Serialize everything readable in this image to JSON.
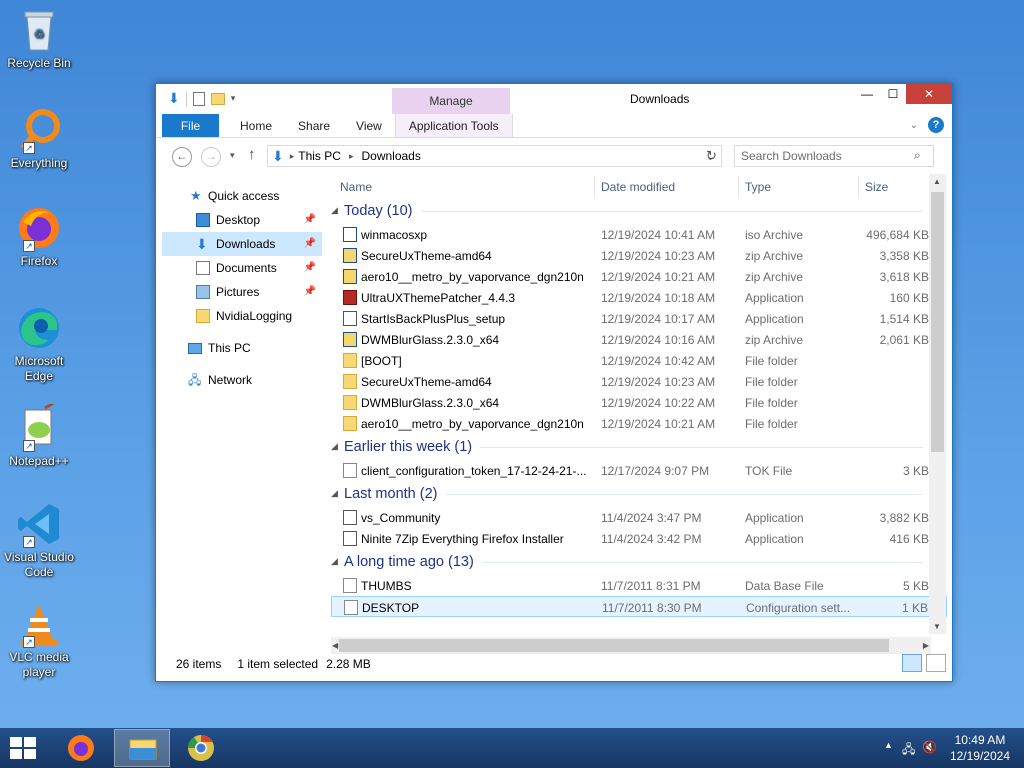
{
  "desktop": {
    "icons": [
      {
        "label": "Recycle Bin",
        "icon": "recycle-bin-icon"
      },
      {
        "label": "Everything",
        "icon": "everything-icon"
      },
      {
        "label": "Firefox",
        "icon": "firefox-icon"
      },
      {
        "label": "Microsoft Edge",
        "icon": "edge-icon"
      },
      {
        "label": "Notepad++",
        "icon": "notepadpp-icon"
      },
      {
        "label": "Visual Studio Code",
        "icon": "vscode-icon"
      },
      {
        "label": "VLC media player",
        "icon": "vlc-icon"
      }
    ]
  },
  "window": {
    "title": "Downloads",
    "manage_tab": "Manage",
    "ribbon": {
      "file": "File",
      "tabs": [
        "Home",
        "Share",
        "View",
        "Application Tools"
      ]
    },
    "address": {
      "segments": [
        "This PC",
        "Downloads"
      ]
    },
    "search": {
      "placeholder": "Search Downloads"
    },
    "nav": {
      "quick_access": "Quick access",
      "items": [
        {
          "label": "Desktop",
          "pinned": true
        },
        {
          "label": "Downloads",
          "pinned": true,
          "selected": true
        },
        {
          "label": "Documents",
          "pinned": true
        },
        {
          "label": "Pictures",
          "pinned": true
        },
        {
          "label": "NvidiaLogging",
          "pinned": false
        }
      ],
      "this_pc": "This PC",
      "network": "Network"
    },
    "columns": {
      "name": "Name",
      "date": "Date modified",
      "type": "Type",
      "size": "Size"
    },
    "groups": [
      {
        "title": "Today (10)",
        "files": [
          {
            "name": "winmacosxp",
            "date": "12/19/2024 10:41 AM",
            "type": "iso Archive",
            "size": "496,684 KB",
            "icon": "iso"
          },
          {
            "name": "SecureUxTheme-amd64",
            "date": "12/19/2024 10:23 AM",
            "type": "zip Archive",
            "size": "3,358 KB",
            "icon": "zip"
          },
          {
            "name": "aero10__metro_by_vaporvance_dgn210n",
            "date": "12/19/2024 10:21 AM",
            "type": "zip Archive",
            "size": "3,618 KB",
            "icon": "zip"
          },
          {
            "name": "UltraUXThemePatcher_4.4.3",
            "date": "12/19/2024 10:18 AM",
            "type": "Application",
            "size": "160 KB",
            "icon": "red"
          },
          {
            "name": "StartIsBackPlusPlus_setup",
            "date": "12/19/2024 10:17 AM",
            "type": "Application",
            "size": "1,514 KB",
            "icon": "app"
          },
          {
            "name": "DWMBlurGlass.2.3.0_x64",
            "date": "12/19/2024 10:16 AM",
            "type": "zip Archive",
            "size": "2,061 KB",
            "icon": "zip"
          },
          {
            "name": "[BOOT]",
            "date": "12/19/2024 10:42 AM",
            "type": "File folder",
            "size": "",
            "icon": "folder"
          },
          {
            "name": "SecureUxTheme-amd64",
            "date": "12/19/2024 10:23 AM",
            "type": "File folder",
            "size": "",
            "icon": "folder"
          },
          {
            "name": "DWMBlurGlass.2.3.0_x64",
            "date": "12/19/2024 10:22 AM",
            "type": "File folder",
            "size": "",
            "icon": "folder"
          },
          {
            "name": "aero10__metro_by_vaporvance_dgn210n",
            "date": "12/19/2024 10:21 AM",
            "type": "File folder",
            "size": "",
            "icon": "folder"
          }
        ]
      },
      {
        "title": "Earlier this week (1)",
        "files": [
          {
            "name": "client_configuration_token_17-12-24-21-...",
            "date": "12/17/2024 9:07 PM",
            "type": "TOK File",
            "size": "3 KB",
            "icon": "file"
          }
        ]
      },
      {
        "title": "Last month (2)",
        "files": [
          {
            "name": "vs_Community",
            "date": "11/4/2024 3:47 PM",
            "type": "Application",
            "size": "3,882 KB",
            "icon": "app"
          },
          {
            "name": "Ninite 7Zip Everything Firefox Installer",
            "date": "11/4/2024 3:42 PM",
            "type": "Application",
            "size": "416 KB",
            "icon": "app"
          }
        ]
      },
      {
        "title": "A long time ago (13)",
        "files": [
          {
            "name": "THUMBS",
            "date": "11/7/2011 8:31 PM",
            "type": "Data Base File",
            "size": "5 KB",
            "icon": "file"
          },
          {
            "name": "DESKTOP",
            "date": "11/7/2011 8:30 PM",
            "type": "Configuration sett...",
            "size": "1 KB",
            "icon": "file",
            "selected": true
          }
        ]
      }
    ],
    "status": {
      "count": "26 items",
      "selection": "1 item selected",
      "size": "2.28 MB"
    }
  },
  "taskbar": {
    "clock_time": "10:49 AM",
    "clock_date": "12/19/2024",
    "apps": [
      "firefox-icon",
      "file-explorer-icon",
      "chrome-icon"
    ]
  },
  "colors": {
    "accent": "#1979ca",
    "manage_tab": "#e8d2f0",
    "group_title": "#1e3287",
    "selection": "#cce8ff",
    "close_button": "#c7403a"
  }
}
